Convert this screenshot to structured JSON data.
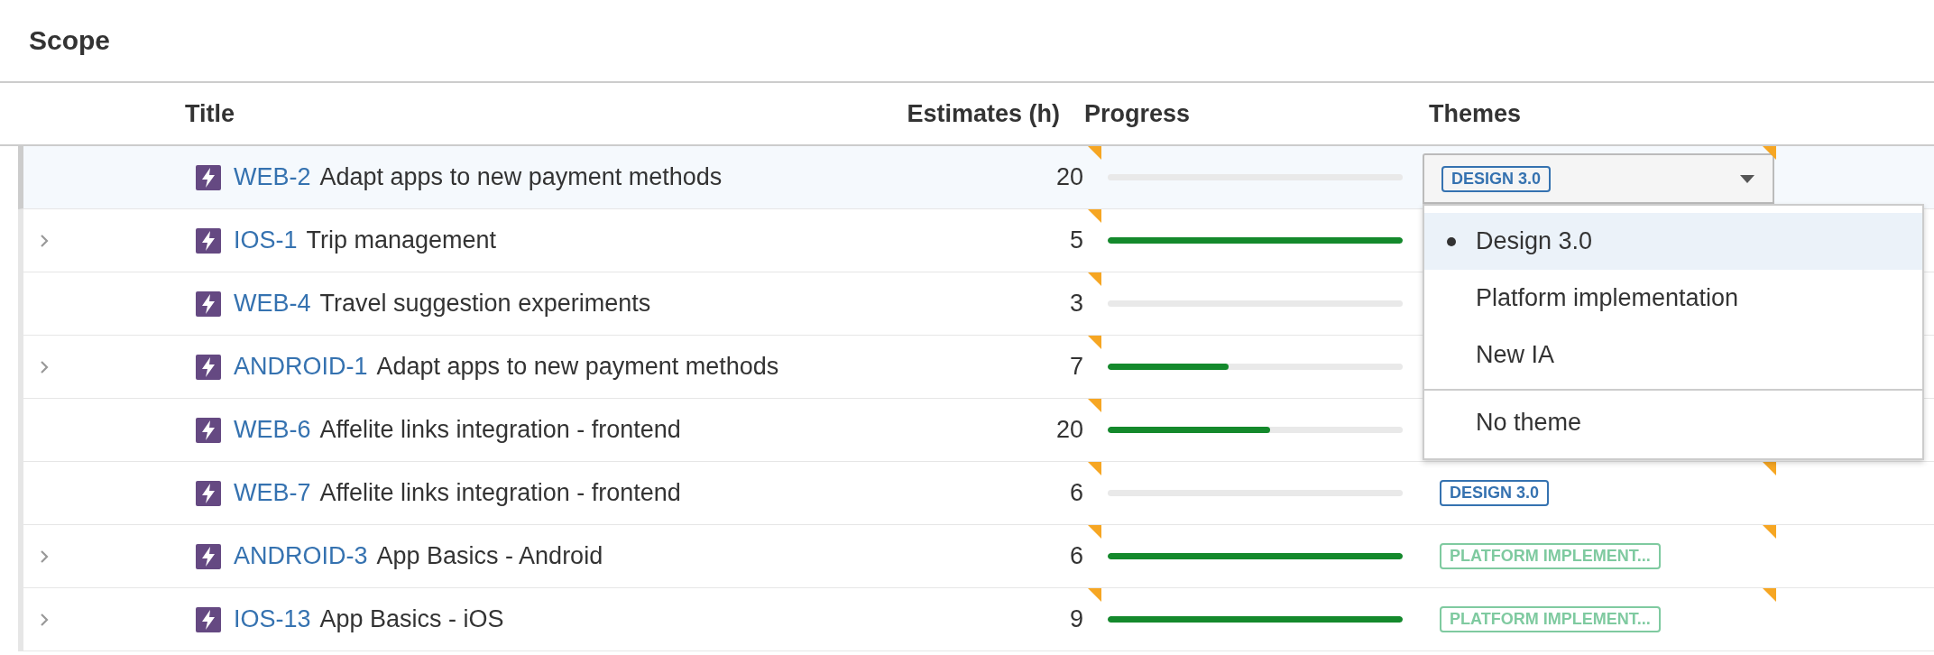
{
  "section_title": "Scope",
  "columns": [
    "Title",
    "Estimates (h)",
    "Progress",
    "Themes"
  ],
  "rows": [
    {
      "selected": true,
      "expandable": false,
      "key": "WEB-2",
      "title": "Adapt apps to new payment methods",
      "estimate": "20",
      "estimate_edited": true,
      "theme": {
        "kind": "select",
        "label": "DESIGN 3.0",
        "color": "#3572b0",
        "edited": true
      }
    },
    {
      "selected": false,
      "expandable": true,
      "key": "IOS-1",
      "title": "Trip management",
      "estimate": "5",
      "estimate_edited": true,
      "level": 1
    },
    {
      "selected": false,
      "expandable": false,
      "key": "WEB-4",
      "title": "Travel suggestion experiments",
      "estimate": "3",
      "estimate_edited": true
    },
    {
      "selected": false,
      "expandable": true,
      "key": "ANDROID-1",
      "title": "Adapt apps to new payment methods",
      "estimate": "7",
      "estimate_edited": true,
      "level": 0.41
    },
    {
      "selected": false,
      "expandable": false,
      "key": "WEB-6",
      "title": "Affelite links integration - frontend",
      "estimate": "20",
      "estimate_edited": true,
      "level": 0.55
    },
    {
      "selected": false,
      "expandable": false,
      "key": "WEB-7",
      "title": "Affelite links integration - frontend",
      "estimate": "6",
      "estimate_edited": true,
      "theme": {
        "kind": "badge",
        "label": "DESIGN 3.0",
        "color": "#3572b0",
        "edited": true
      }
    },
    {
      "selected": false,
      "expandable": true,
      "key": "ANDROID-3",
      "title": "App Basics - Android",
      "estimate": "6",
      "estimate_edited": true,
      "level": 1,
      "theme": {
        "kind": "badge",
        "label": "PLATFORM IMPLEMENT...",
        "color": "#7fcaa0",
        "edited": true
      }
    },
    {
      "selected": false,
      "expandable": true,
      "key": "IOS-13",
      "title": "App Basics - iOS",
      "estimate": "9",
      "estimate_edited": true,
      "level": 1,
      "theme": {
        "kind": "badge",
        "label": "PLATFORM IMPLEMENT...",
        "color": "#7fcaa0",
        "edited": true
      }
    }
  ],
  "theme_menu": {
    "options": [
      {
        "label": "Design 3.0",
        "selected": true
      },
      {
        "label": "Platform implementation",
        "selected": false
      },
      {
        "label": "New IA",
        "selected": false
      }
    ],
    "clear_option": "No theme"
  }
}
